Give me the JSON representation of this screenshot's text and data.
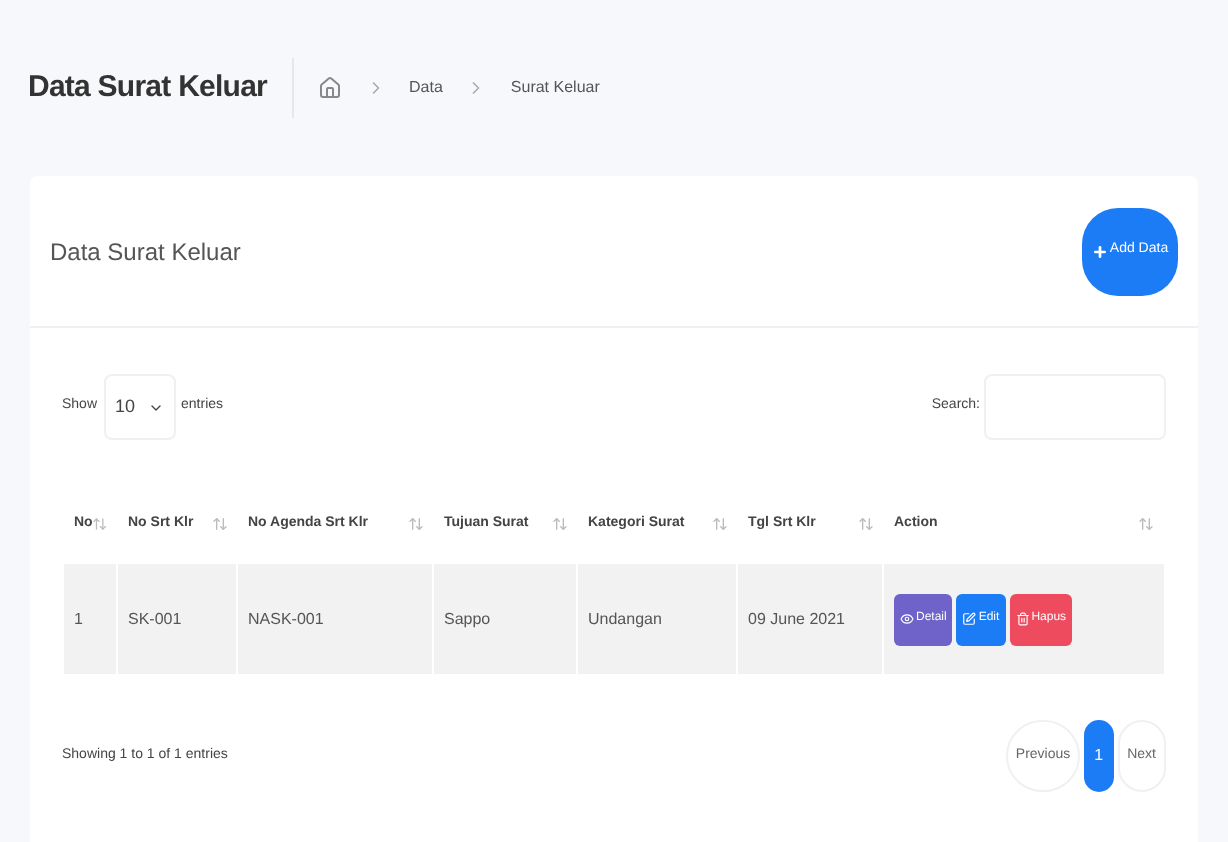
{
  "page_title": "Data Surat Keluar",
  "breadcrumb": [
    "Data",
    "Surat Keluar"
  ],
  "card": {
    "title": "Data Surat Keluar",
    "add_button": "Add Data"
  },
  "length": {
    "prefix": "Show",
    "value": "10",
    "suffix": "entries"
  },
  "search": {
    "label": "Search:"
  },
  "table": {
    "columns": [
      "No",
      "No Srt Klr",
      "No Agenda Srt Klr",
      "Tujuan Surat",
      "Kategori Surat",
      "Tgl Srt Klr",
      "Action"
    ],
    "rows": [
      {
        "cells": [
          "1",
          "SK-001",
          "NASK-001",
          "Sappo",
          "Undangan",
          "09 June 2021"
        ],
        "actions": [
          {
            "kind": "detail",
            "label": "Detail"
          },
          {
            "kind": "edit",
            "label": "Edit"
          },
          {
            "kind": "delete",
            "label": "Hapus"
          }
        ]
      }
    ]
  },
  "info": "Showing 1 to 1 of 1 entries",
  "pagination": [
    {
      "label": "Previous",
      "selected": false
    },
    {
      "label": "1",
      "selected": true
    },
    {
      "label": "Next",
      "selected": false
    }
  ]
}
